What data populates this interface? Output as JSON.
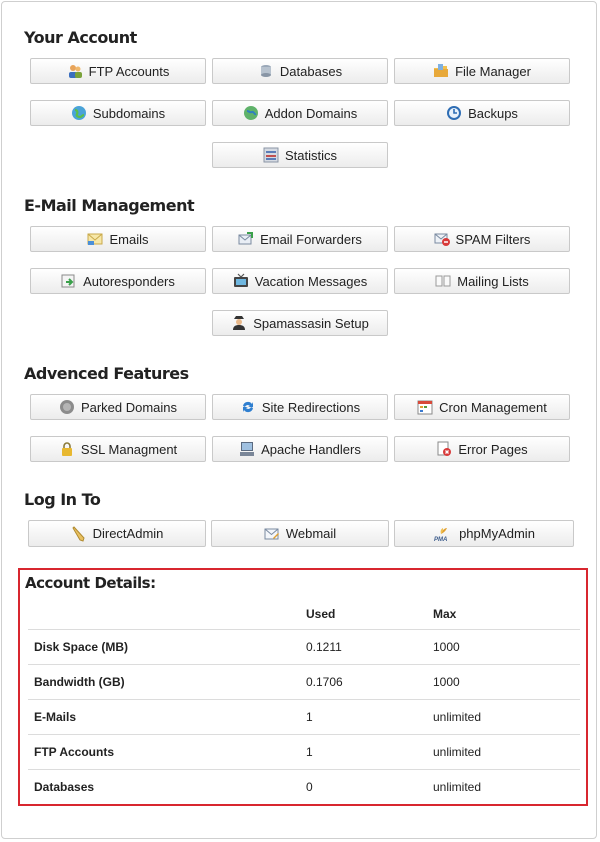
{
  "sections": {
    "your_account": {
      "title": "Your Account",
      "buttons": [
        "FTP Accounts",
        "Databases",
        "File Manager",
        "Subdomains",
        "Addon Domains",
        "Backups",
        "Statistics"
      ]
    },
    "email": {
      "title": "E-Mail Management",
      "buttons": [
        "Emails",
        "Email Forwarders",
        "SPAM Filters",
        "Autoresponders",
        "Vacation Messages",
        "Mailing Lists",
        "Spamassasin Setup"
      ]
    },
    "advanced": {
      "title": "Advenced Features",
      "buttons": [
        "Parked Domains",
        "Site Redirections",
        "Cron Management",
        "SSL Managment",
        "Apache Handlers",
        "Error Pages"
      ]
    },
    "login": {
      "title": "Log In To",
      "buttons": [
        "DirectAdmin",
        "Webmail",
        "phpMyAdmin"
      ]
    }
  },
  "account_details": {
    "title": "Account Details:",
    "headers": [
      "",
      "Used",
      "Max"
    ],
    "rows": [
      [
        "Disk Space (MB)",
        "0.1211",
        "1000"
      ],
      [
        "Bandwidth (GB)",
        "0.1706",
        "1000"
      ],
      [
        "E-Mails",
        "1",
        "unlimited"
      ],
      [
        "FTP Accounts",
        "1",
        "unlimited"
      ],
      [
        "Databases",
        "0",
        "unlimited"
      ]
    ]
  },
  "icons": {
    "accent_border": "#d8262f",
    "pma_label": "PMA"
  }
}
